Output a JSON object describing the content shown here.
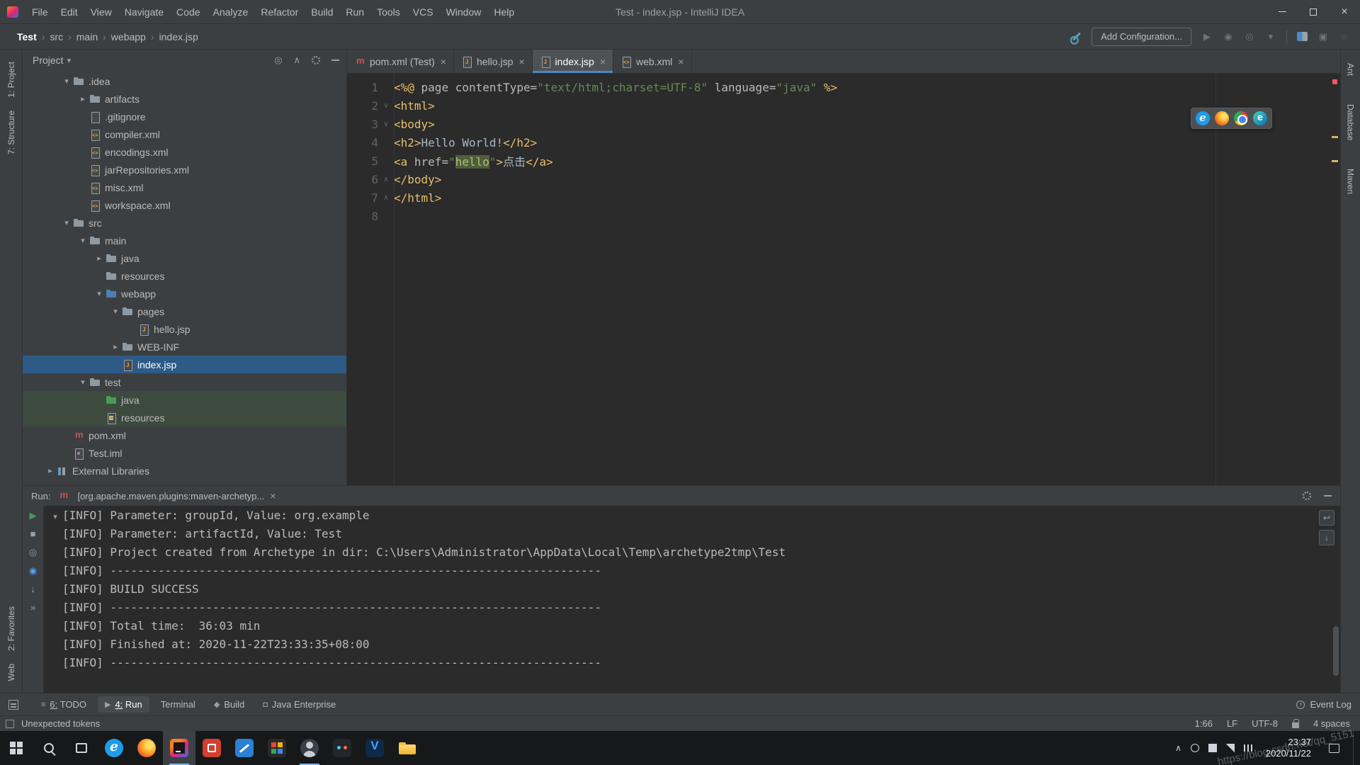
{
  "titlebar": {
    "menus": [
      "File",
      "Edit",
      "View",
      "Navigate",
      "Code",
      "Analyze",
      "Refactor",
      "Build",
      "Run",
      "Tools",
      "VCS",
      "Window",
      "Help"
    ],
    "title": "Test - index.jsp - IntelliJ IDEA"
  },
  "navbar": {
    "breadcrumbs": [
      "Test",
      "src",
      "main",
      "webapp",
      "index.jsp"
    ],
    "add_configuration_label": "Add Configuration..."
  },
  "left_stripe": {
    "top": [
      "1: Project",
      "7: Structure"
    ],
    "bottom": [
      "2: Favorites",
      "Web"
    ]
  },
  "right_stripe": [
    "Ant",
    "Database",
    "Maven"
  ],
  "project_panel": {
    "title": "Project"
  },
  "project_tree": [
    {
      "label": ".idea",
      "level": 1,
      "icon": "folder",
      "arrow": "d",
      "hl": ""
    },
    {
      "label": "artifacts",
      "level": 2,
      "icon": "folder",
      "arrow": "r",
      "hl": ""
    },
    {
      "label": ".gitignore",
      "level": 2,
      "icon": "git",
      "arrow": "",
      "hl": ""
    },
    {
      "label": "compiler.xml",
      "level": 2,
      "icon": "xml",
      "arrow": "",
      "hl": ""
    },
    {
      "label": "encodings.xml",
      "level": 2,
      "icon": "xml",
      "arrow": "",
      "hl": ""
    },
    {
      "label": "jarRepositories.xml",
      "level": 2,
      "icon": "xml",
      "arrow": "",
      "hl": ""
    },
    {
      "label": "misc.xml",
      "level": 2,
      "icon": "xml",
      "arrow": "",
      "hl": ""
    },
    {
      "label": "workspace.xml",
      "level": 2,
      "icon": "xml",
      "arrow": "",
      "hl": ""
    },
    {
      "label": "src",
      "level": 1,
      "icon": "folder",
      "arrow": "d",
      "hl": ""
    },
    {
      "label": "main",
      "level": 2,
      "icon": "folder",
      "arrow": "d",
      "hl": ""
    },
    {
      "label": "java",
      "level": 3,
      "icon": "folder",
      "arrow": "r",
      "hl": ""
    },
    {
      "label": "resources",
      "level": 3,
      "icon": "folder",
      "arrow": "",
      "hl": ""
    },
    {
      "label": "webapp",
      "level": 3,
      "icon": "folder-web",
      "arrow": "d",
      "hl": ""
    },
    {
      "label": "pages",
      "level": 4,
      "icon": "folder",
      "arrow": "d",
      "hl": ""
    },
    {
      "label": "hello.jsp",
      "level": 5,
      "icon": "jsp",
      "arrow": "",
      "hl": ""
    },
    {
      "label": "WEB-INF",
      "level": 4,
      "icon": "folder",
      "arrow": "r",
      "hl": ""
    },
    {
      "label": "index.jsp",
      "level": 4,
      "icon": "jsp",
      "arrow": "",
      "hl": "sel"
    },
    {
      "label": "test",
      "level": 2,
      "icon": "folder",
      "arrow": "d",
      "hl": ""
    },
    {
      "label": "java",
      "level": 3,
      "icon": "folder-test",
      "arrow": "",
      "hl": "green"
    },
    {
      "label": "resources",
      "level": 3,
      "icon": "res",
      "arrow": "",
      "hl": "green"
    },
    {
      "label": "pom.xml",
      "level": 1,
      "icon": "maven",
      "arrow": "",
      "hl": ""
    },
    {
      "label": "Test.iml",
      "level": 1,
      "icon": "iml",
      "arrow": "",
      "hl": ""
    },
    {
      "label": "External Libraries",
      "level": 0,
      "icon": "libs",
      "arrow": "r",
      "hl": ""
    }
  ],
  "editor_tabs": {
    "active_index": 2,
    "items": [
      {
        "label": "pom.xml (Test)",
        "icon": "maven"
      },
      {
        "label": "hello.jsp",
        "icon": "jsp"
      },
      {
        "label": "index.jsp",
        "icon": "jsp"
      },
      {
        "label": "web.xml",
        "icon": "xml"
      }
    ]
  },
  "editor": {
    "lines": [
      {
        "n": "1",
        "fold": "",
        "segs": [
          [
            "tag",
            "<%@"
          ],
          [
            "attr",
            " page contentType="
          ],
          [
            "str",
            "\"text/html;charset=UTF-8\""
          ],
          [
            "attr",
            " language="
          ],
          [
            "str",
            "\"java\""
          ],
          [
            "tag",
            " %>"
          ]
        ]
      },
      {
        "n": "2",
        "fold": "o",
        "segs": [
          [
            "tag",
            "<html>"
          ]
        ]
      },
      {
        "n": "3",
        "fold": "o",
        "segs": [
          [
            "tag",
            "<body>"
          ]
        ]
      },
      {
        "n": "4",
        "fold": "",
        "segs": [
          [
            "tag",
            "<h2>"
          ],
          [
            "txt",
            "Hello World!"
          ],
          [
            "tag",
            "</h2>"
          ]
        ]
      },
      {
        "n": "5",
        "fold": "",
        "segs": [
          [
            "tag",
            "<a "
          ],
          [
            "attr",
            "href="
          ],
          [
            "str",
            "\""
          ],
          [
            "strhl",
            "hello"
          ],
          [
            "str",
            "\""
          ],
          [
            "tag",
            ">"
          ],
          [
            "txt",
            "点击"
          ],
          [
            "tag",
            "</a>"
          ]
        ]
      },
      {
        "n": "6",
        "fold": "c",
        "segs": [
          [
            "tag",
            "</body>"
          ]
        ]
      },
      {
        "n": "7",
        "fold": "c",
        "segs": [
          [
            "tag",
            "</html>"
          ]
        ]
      },
      {
        "n": "8",
        "fold": "",
        "segs": []
      }
    ]
  },
  "browser_preview_icons": [
    "ie",
    "firefox",
    "chrome",
    "edge"
  ],
  "run_panel": {
    "label": "Run:",
    "tab_title": "[org.apache.maven.plugins:maven-archetyp...",
    "left_icons": [
      {
        "name": "rerun",
        "glyph": "▶",
        "color": "#499C54"
      },
      {
        "name": "stop",
        "glyph": "■",
        "color": "#9AA0A6"
      },
      {
        "name": "restore-layout",
        "glyph": "◎",
        "color": "#9AA0A6"
      },
      {
        "name": "pin",
        "glyph": "◉",
        "color": "#589DF6"
      },
      {
        "name": "scroll-down",
        "glyph": "↓",
        "color": "#9AA0A6"
      },
      {
        "name": "more",
        "glyph": "»",
        "color": "#9AA0A6"
      }
    ],
    "console_lines": [
      "[INFO] Parameter: groupId, Value: org.example",
      "[INFO] Parameter: artifactId, Value: Test",
      "[INFO] Project created from Archetype in dir: C:\\Users\\Administrator\\AppData\\Local\\Temp\\archetype2tmp\\Test",
      "[INFO] ------------------------------------------------------------------------",
      "[INFO] BUILD SUCCESS",
      "[INFO] ------------------------------------------------------------------------",
      "[INFO] Total time:  36:03 min",
      "[INFO] Finished at: 2020-11-22T23:33:35+08:00",
      "[INFO] ------------------------------------------------------------------------"
    ]
  },
  "toolwindow_bar": {
    "items": [
      {
        "label": "6: TODO",
        "icon": "todo",
        "active": false
      },
      {
        "label": "4: Run",
        "icon": "run",
        "active": true
      },
      {
        "label": "Terminal",
        "icon": "",
        "active": false
      },
      {
        "label": "Build",
        "icon": "build",
        "active": false
      },
      {
        "label": "Java Enterprise",
        "icon": "cup",
        "active": false
      }
    ],
    "event_log": "Event Log"
  },
  "statusbar": {
    "message": "Unexpected tokens",
    "right": [
      "1:66",
      "LF",
      "UTF-8",
      "4 spaces"
    ]
  },
  "taskbar": {
    "time": "23:37",
    "date": "2020/11/22",
    "apps": [
      {
        "name": "edge-browser",
        "kind": "edge",
        "running": false,
        "active": false
      },
      {
        "name": "firefox-browser",
        "kind": "firefox",
        "running": false,
        "active": false
      },
      {
        "name": "intellij-idea",
        "kind": "idea",
        "running": true,
        "active": true
      },
      {
        "name": "red-app",
        "kind": "red",
        "running": false,
        "active": false
      },
      {
        "name": "vscode",
        "kind": "vscode",
        "running": false,
        "active": false
      },
      {
        "name": "colored-grid-app",
        "kind": "grid",
        "running": false,
        "active": false
      },
      {
        "name": "dark-avatar-app",
        "kind": "avatar",
        "running": true,
        "active": false
      },
      {
        "name": "dark-dots-app",
        "kind": "dots",
        "running": false,
        "active": false
      },
      {
        "name": "blue-v-app",
        "kind": "bluev",
        "running": false,
        "active": false
      },
      {
        "name": "file-explorer",
        "kind": "folder",
        "running": false,
        "active": false
      }
    ]
  },
  "watermark": "https://blog.csdn.net/qq_5151"
}
